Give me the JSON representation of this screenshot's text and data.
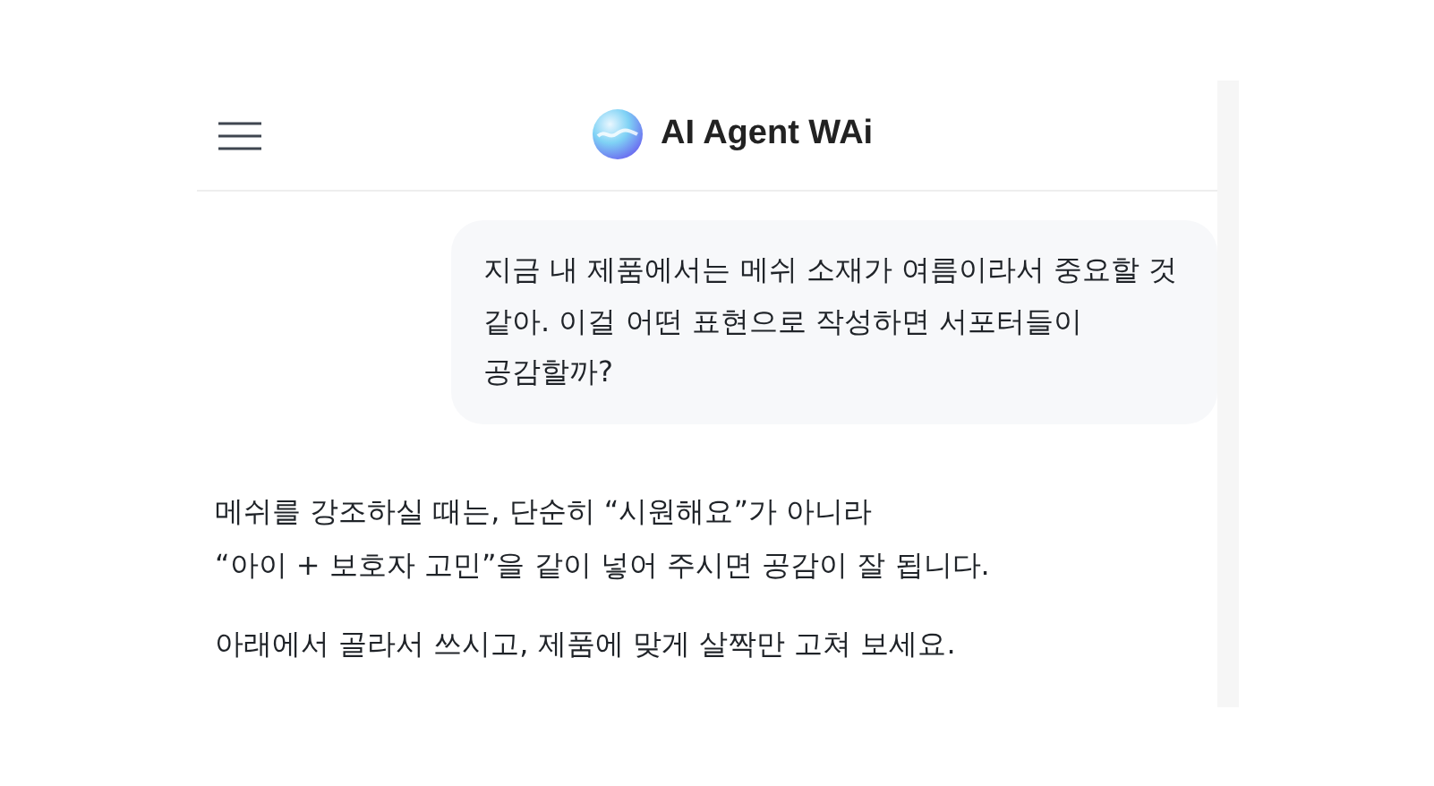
{
  "header": {
    "title": "AI Agent WAi"
  },
  "messages": [
    {
      "kind": "user",
      "paragraphs": [
        "지금 내 제품에서는 메쉬 소재가 여름이라서 중요할 것 같아. 이걸 어떤 표현으로 작성하면 서포터들이 공감할까?"
      ]
    },
    {
      "kind": "assistant",
      "paragraphs": [
        "메쉬를 강조하실 때는, 단순히 “시원해요”가 아니라\n“아이 + 보호자 고민”을 같이 넣어 주시면 공감이 잘 됩니다.",
        "아래에서 골라서 쓰시고, 제품에 맞게 살짝만 고쳐 보세요."
      ]
    }
  ]
}
